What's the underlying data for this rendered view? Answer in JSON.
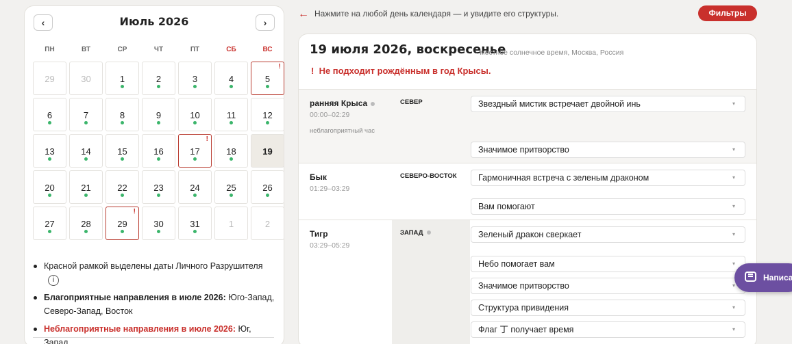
{
  "calendar": {
    "title": "Июль 2026",
    "prev": "‹",
    "next": "›",
    "weekdays": [
      "ПН",
      "ВТ",
      "СР",
      "ЧТ",
      "ПТ",
      "СБ",
      "ВС"
    ],
    "days": [
      "29",
      "30",
      "1",
      "2",
      "3",
      "4",
      "5",
      "6",
      "7",
      "8",
      "9",
      "10",
      "11",
      "12",
      "13",
      "14",
      "15",
      "16",
      "17",
      "18",
      "19",
      "20",
      "21",
      "22",
      "23",
      "24",
      "25",
      "26",
      "27",
      "28",
      "29",
      "30",
      "31",
      "1",
      "2"
    ],
    "destruction_mark": "!"
  },
  "notes": {
    "frame_text": "Красной рамкой выделены даты Личного Разрушителя",
    "info_icon": "i",
    "favorable_label": "Благоприятные направления в июле 2026:",
    "favorable_value": "Юго-Запад, Северо-Запад, Восток",
    "unfavorable_label": "Неблагоприятные направления в июле 2026:",
    "unfavorable_value": "Юг, Запад"
  },
  "hint": {
    "arrow": "←",
    "text": "Нажмите на любой день календаря — и увидите его структуры."
  },
  "filters_button": "Фильтры",
  "detail": {
    "date_title": "19 июля 2026, воскресенье",
    "date_sub": "· местное солнечное время, Москва, Россия",
    "warning_mark": "!",
    "warning": "Не подходит рождённым в год Крысы."
  },
  "slots": [
    {
      "name": "ранняя Крыса",
      "time": "00:00–02:29",
      "note": "неблагоприятный час",
      "dir": "СЕВЕР",
      "items": [
        "Звездный мистик встречает двойной инь",
        "Значимое притворство"
      ]
    },
    {
      "name": "Бык",
      "time": "01:29–03:29",
      "dir": "СЕВЕРО-ВОСТОК",
      "items": [
        "Гармоничная встреча с зеленым драконом",
        "Вам помогают"
      ]
    },
    {
      "name": "Тигр",
      "time": "03:29–05:29",
      "dir": "ЗАПАД",
      "items": [
        "Зеленый дракон сверкает",
        "Небо помогает вам",
        "Значимое притворство",
        "Структура привидения",
        "Флаг 丁 получает время"
      ]
    }
  ],
  "chat_button": "Написать",
  "colors": {
    "accent": "#c9302c",
    "good_dot": "#3bb56b",
    "chat": "#6c4fa1"
  }
}
